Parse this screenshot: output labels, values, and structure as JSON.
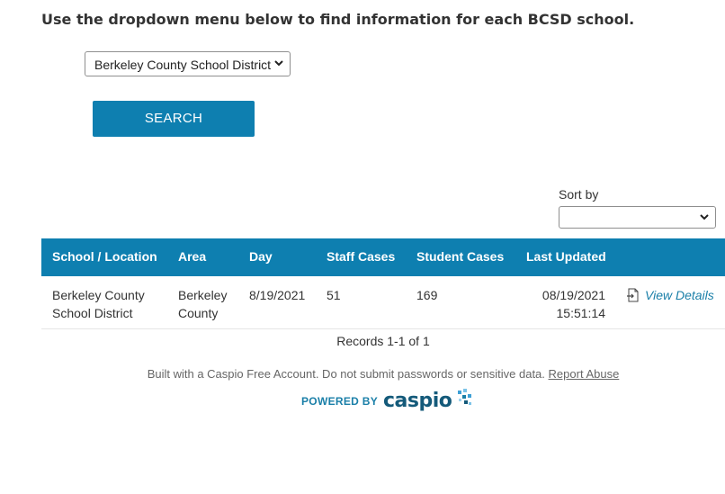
{
  "heading": "Use the dropdown menu below to find information for each BCSD school.",
  "school_select": {
    "selected": "Berkeley County School District",
    "icon": "chevron-down-icon"
  },
  "search_button": "SEARCH",
  "sort": {
    "label": "Sort by",
    "selected": ""
  },
  "table": {
    "headers": [
      "School / Location",
      "Area",
      "Day",
      "Staff Cases",
      "Student Cases",
      "Last Updated"
    ],
    "rows": [
      {
        "school_line1": "Berkeley County",
        "school_line2": "School District",
        "area_line1": "Berkeley",
        "area_line2": "County",
        "day": "8/19/2021",
        "staff_cases": "51",
        "student_cases": "169",
        "updated_date": "08/19/2021",
        "updated_time": "15:51:14",
        "details_link": "View Details",
        "details_icon": "document-arrow-icon"
      }
    ]
  },
  "records_text": "Records 1-1 of 1",
  "footer": {
    "note": "Built with a Caspio Free Account. Do not submit passwords or sensitive data.",
    "report_link": "Report Abuse",
    "powered_by": "POWERED BY",
    "logo_text": "caspio"
  },
  "colors": {
    "accent": "#0e7fb0",
    "link": "#1a7fa8"
  }
}
